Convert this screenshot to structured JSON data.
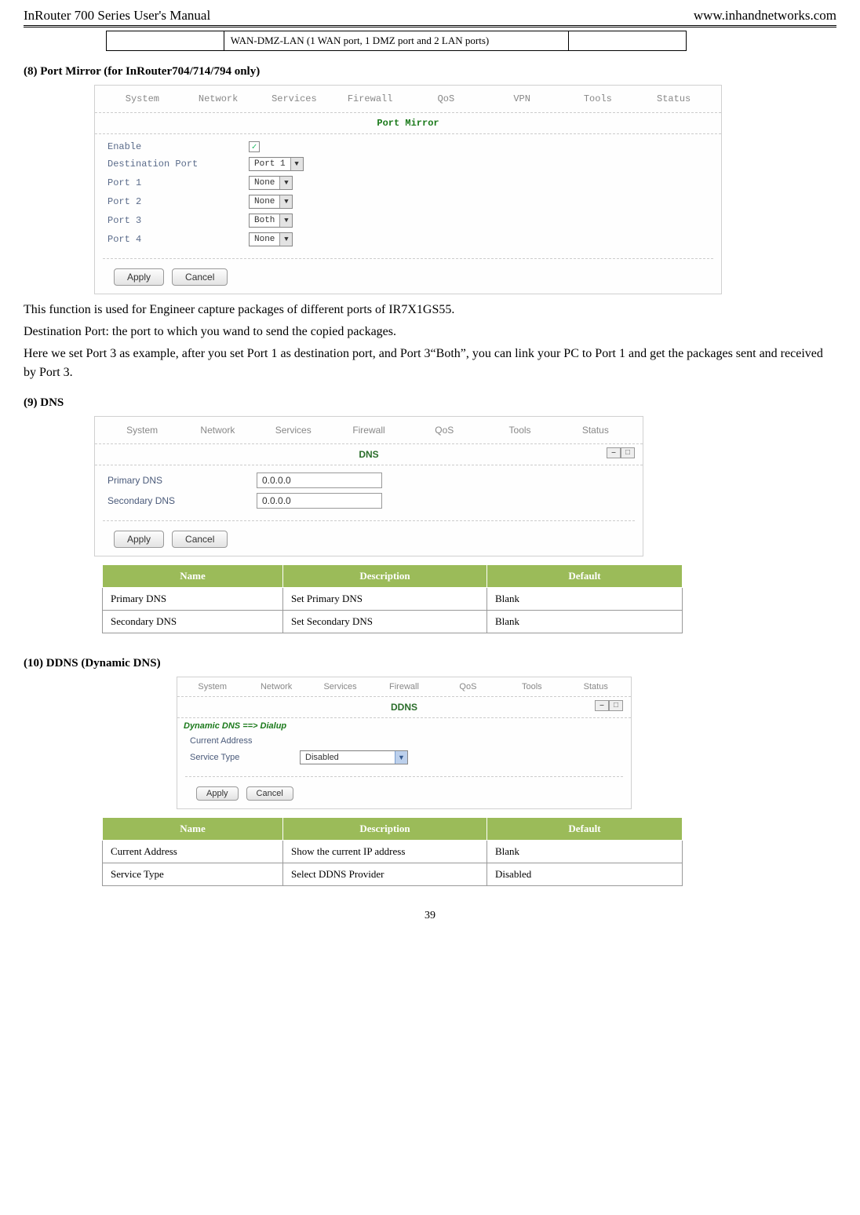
{
  "header": {
    "left": "InRouter 700 Series User's Manual",
    "right": "www.inhandnetworks.com"
  },
  "wantable": {
    "cell": "WAN-DMZ-LAN (1 WAN port, 1 DMZ port and 2 LAN ports)"
  },
  "section8": "(8)  Port Mirror (for InRouter704/714/794 only)",
  "shot1": {
    "nav": [
      "System",
      "Network",
      "Services",
      "Firewall",
      "QoS",
      "VPN",
      "Tools",
      "Status"
    ],
    "title": "Port Mirror",
    "rows": {
      "enable": "Enable",
      "destport_lbl": "Destination Port",
      "destport_val": "Port 1",
      "p1_lbl": "Port 1",
      "p1_val": "None",
      "p2_lbl": "Port 2",
      "p2_val": "None",
      "p3_lbl": "Port 3",
      "p3_val": "Both",
      "p4_lbl": "Port 4",
      "p4_val": "None"
    },
    "apply": "Apply",
    "cancel": "Cancel"
  },
  "para1": "This function is used for Engineer capture packages of different ports of IR7X1GS55.",
  "para2": "Destination Port: the port to which you wand to send the copied packages.",
  "para3": "Here we set Port 3 as example, after you set Port 1 as destination port, and Port 3“Both”, you can link your PC to Port 1 and get the packages sent and received by Port 3.",
  "section9": "(9)  DNS",
  "shot2": {
    "nav": [
      "System",
      "Network",
      "Services",
      "Firewall",
      "QoS",
      "Tools",
      "Status"
    ],
    "title": "DNS",
    "primary_lbl": "Primary DNS",
    "primary_val": "0.0.0.0",
    "secondary_lbl": "Secondary DNS",
    "secondary_val": "0.0.0.0",
    "apply": "Apply",
    "cancel": "Cancel"
  },
  "dns_table": {
    "headers": [
      "Name",
      "Description",
      "Default"
    ],
    "rows": [
      [
        "Primary DNS",
        "Set Primary DNS",
        "Blank"
      ],
      [
        "Secondary DNS",
        "Set Secondary DNS",
        "Blank"
      ]
    ]
  },
  "section10": "(10) DDNS (Dynamic DNS)",
  "shot3": {
    "nav": [
      "System",
      "Network",
      "Services",
      "Firewall",
      "QoS",
      "Tools",
      "Status"
    ],
    "title": "DDNS",
    "breadcrumb": "Dynamic DNS ==> Dialup",
    "curr_lbl": "Current Address",
    "svc_lbl": "Service Type",
    "svc_val": "Disabled",
    "apply": "Apply",
    "cancel": "Cancel"
  },
  "ddns_table": {
    "headers": [
      "Name",
      "Description",
      "Default"
    ],
    "rows": [
      [
        "Current Address",
        "Show the current IP address",
        "Blank"
      ],
      [
        "Service Type",
        "Select DDNS Provider",
        "Disabled"
      ]
    ]
  },
  "page_num": "39"
}
